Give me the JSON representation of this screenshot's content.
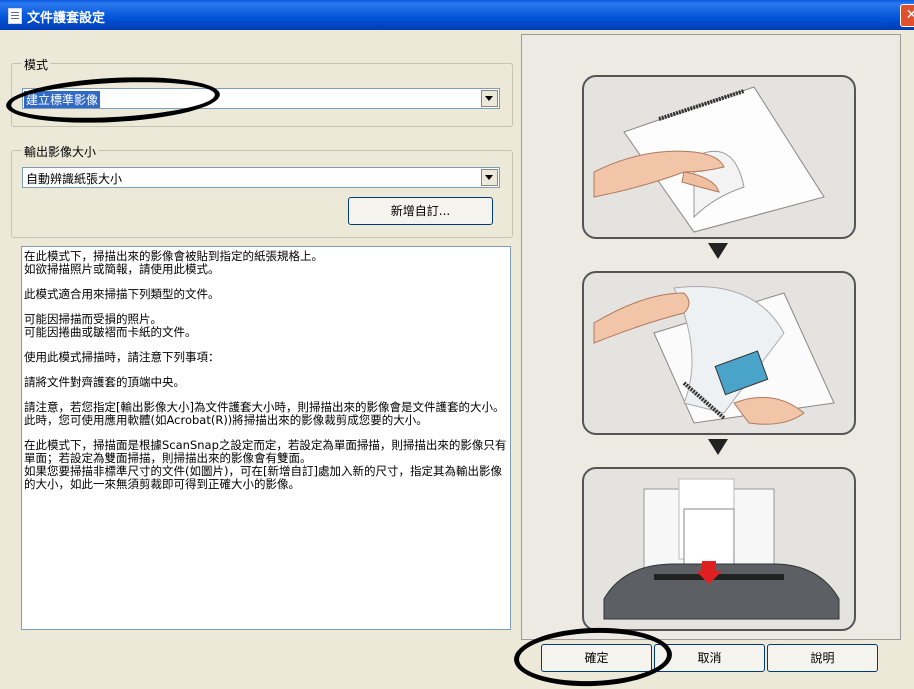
{
  "window": {
    "title": "文件護套設定",
    "close_glyph": "✕"
  },
  "mode_group": {
    "legend": "模式",
    "selected": "建立標準影像"
  },
  "output_group": {
    "legend": "輸出影像大小",
    "selected": "自動辨識紙張大小",
    "add_custom_label": "新增自訂..."
  },
  "description": {
    "paragraphs": [
      "在此模式下，掃描出來的影像會被貼到指定的紙張規格上。\n如欲掃描照片或簡報，請使用此模式。",
      "此模式適合用來掃描下列類型的文件。",
      "可能因掃描而受損的照片。\n可能因捲曲或皺褶而卡紙的文件。",
      "使用此模式掃描時，請注意下列事項：",
      "請將文件對齊護套的頂端中央。",
      "請注意，若您指定[輸出影像大小]為文件護套大小時，則掃描出來的影像會是文件護套的大小。\n此時，您可使用應用軟體(如Acrobat(R))將掃描出來的影像裁剪成您要的大小。",
      "在此模式下，掃描面是根據ScanSnap之設定而定，若設定為單面掃描，則掃描出來的影像只有單面；若設定為雙面掃描，則掃描出來的影像會有雙面。\n如果您要掃描非標準尺寸的文件(如圖片)，可在[新增自訂]處加入新的尺寸，指定其為輸出影像的大小，如此一來無須剪裁即可得到正確大小的影像。"
    ]
  },
  "buttons": {
    "ok": "確定",
    "cancel": "取消",
    "help": "說明"
  },
  "colors": {
    "title_bar": "#0053d9",
    "selection": "#316ac5",
    "dialog_bg": "#ece9d8"
  }
}
